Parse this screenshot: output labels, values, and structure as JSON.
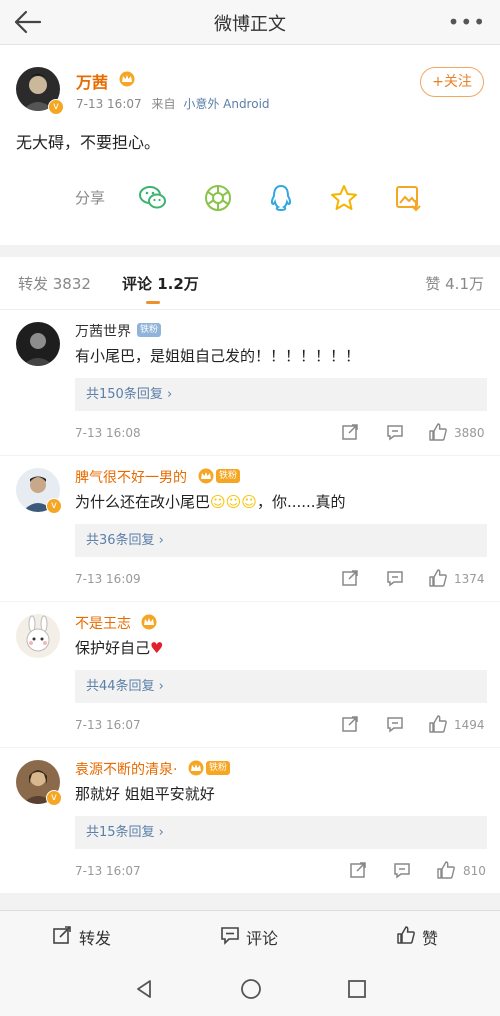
{
  "header": {
    "title": "微博正文",
    "more": "•••"
  },
  "post": {
    "author": "万茜",
    "time": "7-13 16:07",
    "source_prefix": "来自",
    "source": "小意外 Android",
    "follow_label": "+关注",
    "content": "无大碍，不要担心。",
    "share_label": "分享",
    "share_targets": [
      "wechat-icon",
      "moments-icon",
      "qq-icon",
      "qzone-star-icon",
      "save-image-icon"
    ]
  },
  "tabs": {
    "repost": "转发 3832",
    "comment": "评论 1.2万",
    "like": "赞 4.1万"
  },
  "comments": [
    {
      "name": "万茜世界",
      "badge": "铁粉",
      "text": "有小尾巴，是姐姐自己发的！！！！！！！",
      "replies": "共150条回复 ›",
      "time": "7-13 16:08",
      "likes": "3880",
      "name_color": "#333333"
    },
    {
      "name": "脾气很不好一男的",
      "badge": "铁粉",
      "text": "为什么还在改小尾巴",
      "text2": "，你......真的",
      "replies": "共36条回复 ›",
      "time": "7-13 16:09",
      "likes": "1374",
      "name_color": "#e86b00"
    },
    {
      "name": "不是王志",
      "badge": "",
      "text": "保护好自己",
      "replies": "共44条回复 ›",
      "time": "7-13 16:07",
      "likes": "1494",
      "name_color": "#e86b00"
    },
    {
      "name": "袁源不断的清泉·",
      "badge": "铁粉",
      "text": "那就好 姐姐平安就好",
      "replies": "共15条回复 ›",
      "time": "7-13 16:07",
      "likes": "810",
      "name_color": "#e86b00"
    }
  ],
  "bottom": {
    "repost": "转发",
    "comment": "评论",
    "like": "赞"
  },
  "colors": {
    "accent": "#f0902a",
    "link": "#5b7fa8",
    "vip_name": "#e86b00"
  }
}
